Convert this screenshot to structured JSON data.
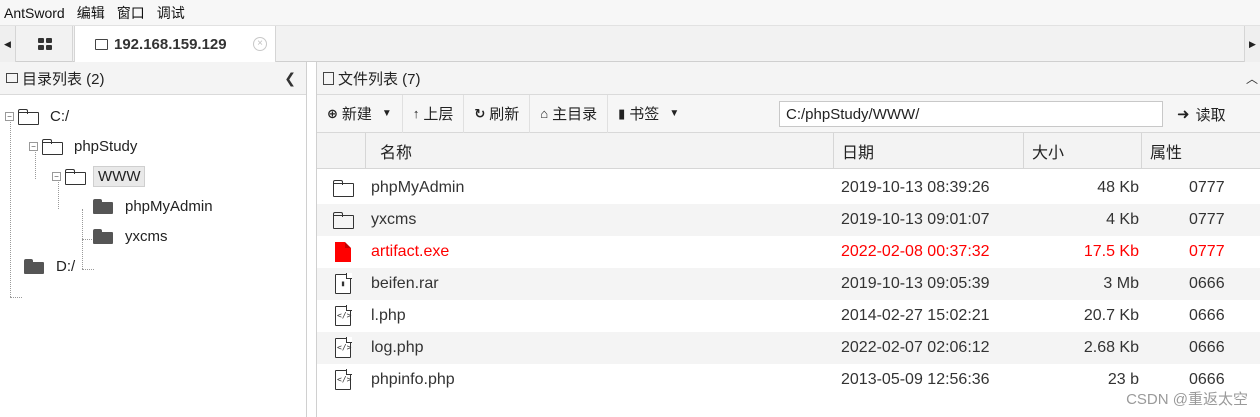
{
  "menu": [
    "AntSword",
    "编辑",
    "窗口",
    "调试"
  ],
  "tabs": {
    "active_label": "192.168.159.129",
    "close_glyph": "×"
  },
  "dir_panel": {
    "title": "目录列表 (2)",
    "tree": [
      {
        "label": "C:/",
        "expanded": true,
        "level": 0
      },
      {
        "label": "phpStudy",
        "expanded": true,
        "level": 1
      },
      {
        "label": "WWW",
        "expanded": true,
        "level": 2,
        "selected": true
      },
      {
        "label": "phpMyAdmin",
        "level": 3
      },
      {
        "label": "yxcms",
        "level": 3
      },
      {
        "label": "D:/",
        "level": 0
      }
    ]
  },
  "file_panel": {
    "title": "文件列表 (7)",
    "toolbar": {
      "new_label": "新建",
      "up_label": "上层",
      "refresh_label": "刷新",
      "home_label": "主目录",
      "bookmark_label": "书签",
      "path_value": "C:/phpStudy/WWW/",
      "read_label": "读取"
    },
    "columns": [
      "名称",
      "日期",
      "大小",
      "属性"
    ],
    "rows": [
      {
        "icon": "folder-icon",
        "name": "phpMyAdmin",
        "date": "2019-10-13 08:39:26",
        "size": "48 Kb",
        "attr": "0777"
      },
      {
        "icon": "folder-icon",
        "name": "yxcms",
        "date": "2019-10-13 09:01:07",
        "size": "4 Kb",
        "attr": "0777"
      },
      {
        "icon": "red-file-icon",
        "name": "artifact.exe",
        "date": "2022-02-08 00:37:32",
        "size": "17.5 Kb",
        "attr": "0777",
        "highlight": "#ff0000"
      },
      {
        "icon": "archive-file-icon",
        "name": "beifen.rar",
        "date": "2019-10-13 09:05:39",
        "size": "3 Mb",
        "attr": "0666"
      },
      {
        "icon": "code-file-icon",
        "name": "l.php",
        "date": "2014-02-27 15:02:21",
        "size": "20.7 Kb",
        "attr": "0666"
      },
      {
        "icon": "code-file-icon",
        "name": "log.php",
        "date": "2022-02-07 02:06:12",
        "size": "2.68 Kb",
        "attr": "0666"
      },
      {
        "icon": "code-file-icon",
        "name": "phpinfo.php",
        "date": "2013-05-09 12:56:36",
        "size": "23 b",
        "attr": "0666"
      }
    ]
  },
  "watermark": "CSDN @重返太空"
}
